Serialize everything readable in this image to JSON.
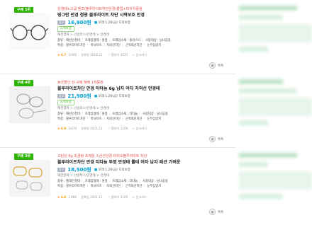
{
  "products": [
    {
      "rank": "구매 1위",
      "subtitle": "안경테+고급 렌즈(블루라이트차단안경)클립+파우치증정",
      "title": "링그란 안경 청광 블루라이트 차단 시력보호 안경",
      "ad_label": "광고",
      "price": "16,900원",
      "shipping": "모레 1.26(금) 도착보장",
      "badge": "도착보장",
      "category": "패션잡화 > 선글라스/안경테 > 안경테",
      "specs_line1": [
        "종류 : 패션안경테",
        "프레임형태 : 원형",
        "프레임소재 : 플라스틱",
        "사용대상 : 남녀공용"
      ],
      "specs_line2": [
        "특징 : 블루라이트차단",
        "빅사이즈",
        "자외선차단",
        "근적외선차단",
        "눈부심방지"
      ],
      "rating": "4.7",
      "reviews": "3,900",
      "date": "등록일 2018.11.",
      "wish": "찜하기 4531",
      "report": "신고하기",
      "fav_label": "톡톡"
    },
    {
      "rank": "구매 4위",
      "subtitle": "늦은할인 한 구매 혜택 1개증정",
      "title": "블루라이트차단 안경 티타늄 6g 남자 여자 자외선 안경테",
      "ad_label": "광고",
      "price": "21,900원",
      "shipping": "모레 1.26(금) 도착보장",
      "badge": "도착보장",
      "category": "패션잡화 > 선글라스/안경테 > 안경테",
      "specs_line1": [
        "종류 : 패션안경테",
        "프레임형태 : 원형",
        "프레임소재 : 티타늄",
        "사용대상 : 남녀공용"
      ],
      "specs_line2": [
        "특징 : 블루라이트차단",
        "빅사이즈",
        "자외선차단",
        "근적외선차단",
        "눈부심방지"
      ],
      "rating": "4.9",
      "reviews": "3,670",
      "date": "등록일 2021.11.",
      "wish": "찜하기 1100",
      "report": "신고하기",
      "fav_label": "톡톡"
    },
    {
      "rank": "구매 3위",
      "subtitle": "고탄성 6g 초경량 프레임 스산선안경 타이오블루라이트 차단",
      "title": "블루라이트차단 안경 티타늄 투명 안경테 뿔테 여자 남자 패션 가벼운",
      "ad_label": "광고",
      "price": "18,500원",
      "shipping": "모레 1.26(금) 도착보장",
      "badge": "",
      "category": "패션잡화 > 선글라스/안경테 > 안경테",
      "specs_line1": [
        "종류 : 뿔테안경테",
        "프레임형태 : 원형",
        "프레임소재 : 티타늄",
        "사용대상 : 남녀공용"
      ],
      "specs_line2": [
        "특징 : 블루라이트차단",
        "빅사이즈",
        "자외선차단",
        "근적외선차단",
        "눈부심방지"
      ],
      "rating": "4.8",
      "reviews": "1,800",
      "date": "등록일 2021.11.",
      "wish": "찜하기 3109",
      "report": "신고하기",
      "fav_label": "톡톡"
    }
  ],
  "colors": {
    "accent": "#2db400",
    "price": "#00a0d2",
    "promo": "#e84b4b",
    "star": "#f2a000"
  },
  "icons": [
    "star-icon",
    "heart-icon",
    "siren-icon",
    "chat-icon",
    "truck-icon"
  ]
}
